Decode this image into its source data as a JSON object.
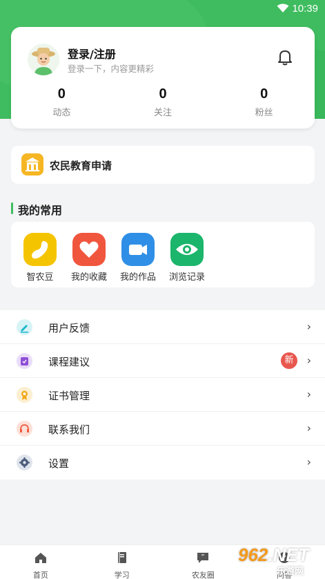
{
  "status_bar": {
    "time": "10:39"
  },
  "profile": {
    "title": "登录/注册",
    "subtitle": "登录一下，内容更精彩",
    "stats": [
      {
        "value": "0",
        "label": "动态"
      },
      {
        "value": "0",
        "label": "关注"
      },
      {
        "value": "0",
        "label": "粉丝"
      }
    ]
  },
  "education": {
    "label": "农民教育申请"
  },
  "common": {
    "title": "我的常用",
    "items": [
      {
        "label": "智农豆",
        "color": "#f5c400"
      },
      {
        "label": "我的收藏",
        "color": "#f0563e"
      },
      {
        "label": "我的作品",
        "color": "#2f8fe6"
      },
      {
        "label": "浏览记录",
        "color": "#1bb56b"
      }
    ]
  },
  "menu": {
    "items": [
      {
        "label": "用户反馈",
        "icon": "edit-icon",
        "color": "#1ab6c9"
      },
      {
        "label": "课程建议",
        "icon": "suggestion-icon",
        "color": "#8e4fd6",
        "badge": "新"
      },
      {
        "label": "证书管理",
        "icon": "certificate-icon",
        "color": "#f2a81c"
      },
      {
        "label": "联系我们",
        "icon": "headset-icon",
        "color": "#ef5a3c"
      },
      {
        "label": "设置",
        "icon": "gear-icon",
        "color": "#4b5b7a"
      }
    ],
    "chevron": "›"
  },
  "tabbar": {
    "items": [
      {
        "label": "首页",
        "icon": "home-icon"
      },
      {
        "label": "学习",
        "icon": "book-icon"
      },
      {
        "label": "农友圈",
        "icon": "chat-icon"
      },
      {
        "label": "问答",
        "icon": "question-icon"
      }
    ]
  },
  "watermark": {
    "brand": "962",
    "suffix": ".NET",
    "sub": "乐游网"
  },
  "colors": {
    "accent": "#3fbc5f",
    "badge": "#e8574e"
  }
}
